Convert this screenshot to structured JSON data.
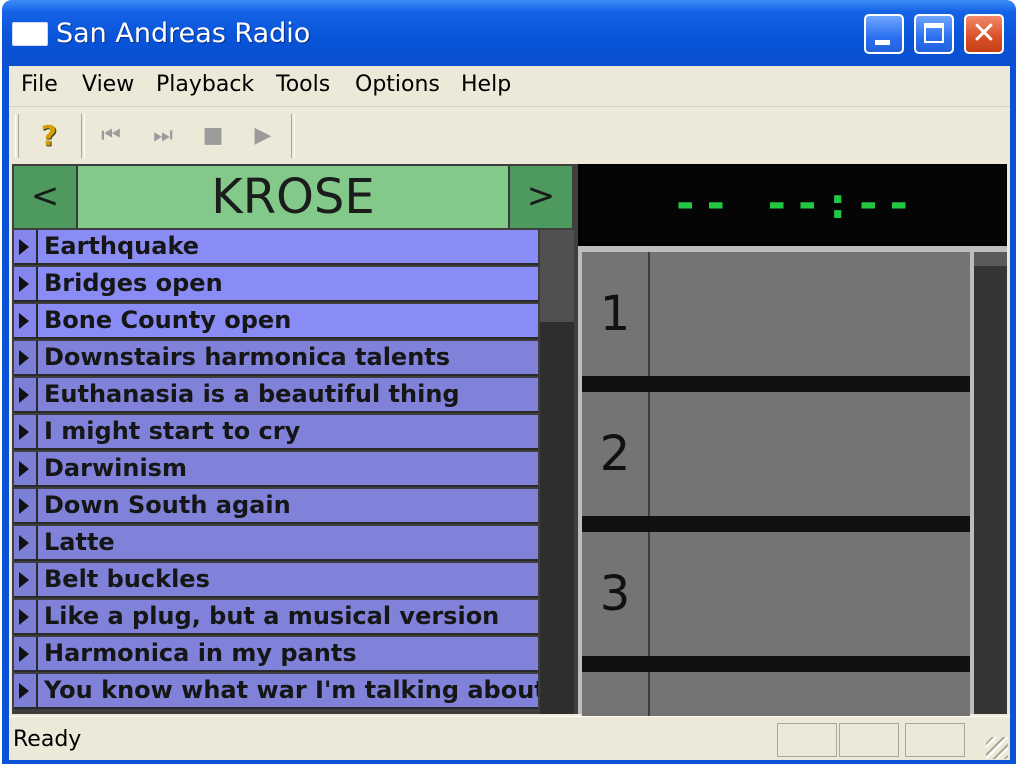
{
  "window": {
    "title": "San Andreas Radio",
    "minimize_label": "",
    "maximize_label": "",
    "close_label": "✕"
  },
  "menu": [
    "File",
    "View",
    "Playback",
    "Tools",
    "Options",
    "Help"
  ],
  "toolbar": {
    "help_icon": "help-icon",
    "help_glyph": "?",
    "prev_glyph": "⏮",
    "next_glyph": "⏭",
    "stop_glyph": "■",
    "play_glyph": "▶"
  },
  "station": {
    "prev": "<",
    "name": "KROSE",
    "next": ">"
  },
  "tracks": [
    "Earthquake",
    "Bridges open",
    "Bone County open",
    "Downstairs harmonica talents",
    "Euthanasia is a beautiful thing",
    "I might start to cry",
    "Darwinism",
    "Down South again",
    "Latte",
    "Belt buckles",
    "Like a plug, but a musical version",
    "Harmonica in my pants",
    "You know what war I'm talking about"
  ],
  "display": {
    "time": "-- --:--"
  },
  "slots": [
    "1",
    "2",
    "3",
    ""
  ],
  "status": {
    "text": "Ready"
  },
  "colors": {
    "lcd_text": "#22c742",
    "station_bg": "#82c98a",
    "track_bg": "#7f82d8",
    "title_bar": "#0a52d6"
  }
}
